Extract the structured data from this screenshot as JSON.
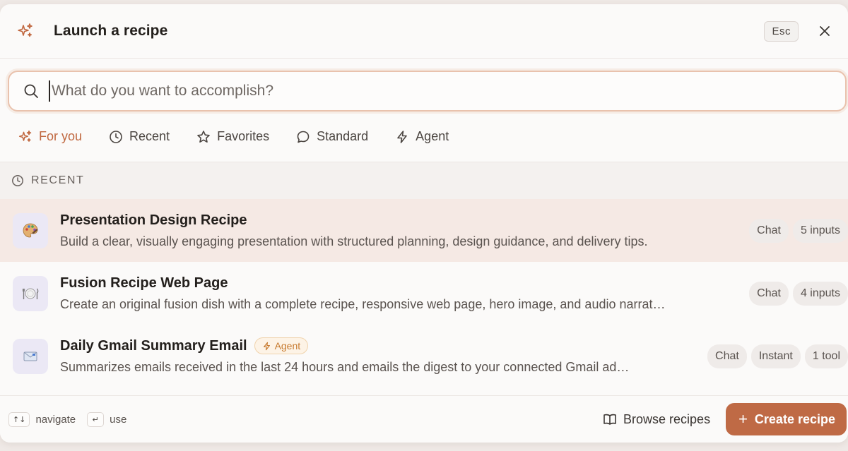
{
  "header": {
    "title": "Launch a recipe",
    "esc_label": "Esc"
  },
  "search": {
    "placeholder": "What do you want to accomplish?",
    "value": ""
  },
  "tabs": [
    {
      "label": "For you",
      "icon": "sparkles-icon",
      "active": true
    },
    {
      "label": "Recent",
      "icon": "clock-icon",
      "active": false
    },
    {
      "label": "Favorites",
      "icon": "star-icon",
      "active": false
    },
    {
      "label": "Standard",
      "icon": "chat-bubble-icon",
      "active": false
    },
    {
      "label": "Agent",
      "icon": "lightning-icon",
      "active": false
    }
  ],
  "section": {
    "label": "RECENT"
  },
  "recipes": [
    {
      "name": "Presentation Design Recipe",
      "description": "Build a clear, visually engaging presentation with structured planning, design guidance, and delivery tips.",
      "icon": "palette-icon",
      "badge": "",
      "chips": [
        "Chat",
        "5 inputs"
      ]
    },
    {
      "name": "Fusion Recipe Web Page",
      "description": "Create an original fusion dish with a complete recipe, responsive web page, hero image, and audio narrat…",
      "icon": "plate-utensils-icon",
      "badge": "",
      "chips": [
        "Chat",
        "4 inputs"
      ]
    },
    {
      "name": "Daily Gmail Summary Email",
      "description": "Summarizes emails received in the last 24 hours and emails the digest to your connected Gmail ad…",
      "icon": "envelope-icon",
      "badge": "Agent",
      "chips": [
        "Chat",
        "Instant",
        "1 tool"
      ]
    }
  ],
  "footer": {
    "navigate_key": "↑↓",
    "navigate_label": "navigate",
    "use_key": "↵",
    "use_label": "use",
    "browse_label": "Browse recipes",
    "create_label": "Create recipe"
  },
  "colors": {
    "accent": "#c0673f",
    "button": "#bf6a45",
    "active_row": "#f5e9e4",
    "agent_badge": "#c77a2f"
  }
}
